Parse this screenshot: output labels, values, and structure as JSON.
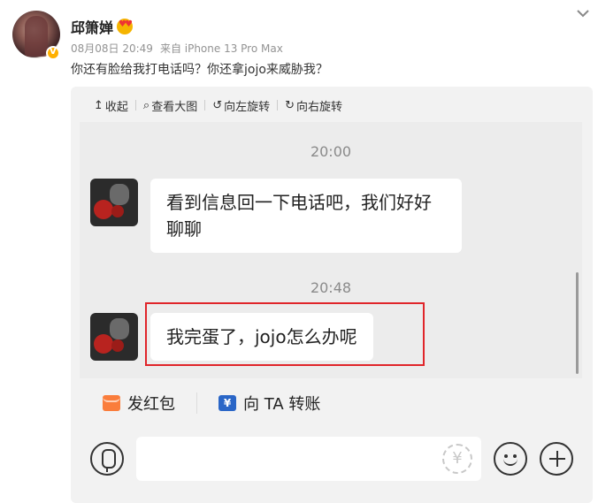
{
  "post": {
    "username": "邱箫婵",
    "date": "08月08日 20:49",
    "source": "来自 iPhone 13 Pro Max",
    "text": "你还有脸给我打电话吗？你还拿jojo来威胁我？"
  },
  "toolbar": {
    "collapse": "收起",
    "view_large": "查看大图",
    "rotate_left": "向左旋转",
    "rotate_right": "向右旋转",
    "collapse_icon": "↥",
    "view_icon": "⌕",
    "rotate_left_icon": "↺",
    "rotate_right_icon": "↻"
  },
  "chat": {
    "messages": [
      {
        "time": "20:00",
        "text": "看到信息回一下电话吧，我们好好聊聊"
      },
      {
        "time": "20:48",
        "text": "我完蛋了，jojo怎么办呢"
      }
    ]
  },
  "actions": {
    "red_packet": "发红包",
    "transfer": "向 TA 转账",
    "transfer_icon": "¥",
    "yen_icon": "¥"
  },
  "colors": {
    "highlight": "#e0252a",
    "red_packet": "#fa7d3c",
    "transfer": "#2a66c7"
  }
}
